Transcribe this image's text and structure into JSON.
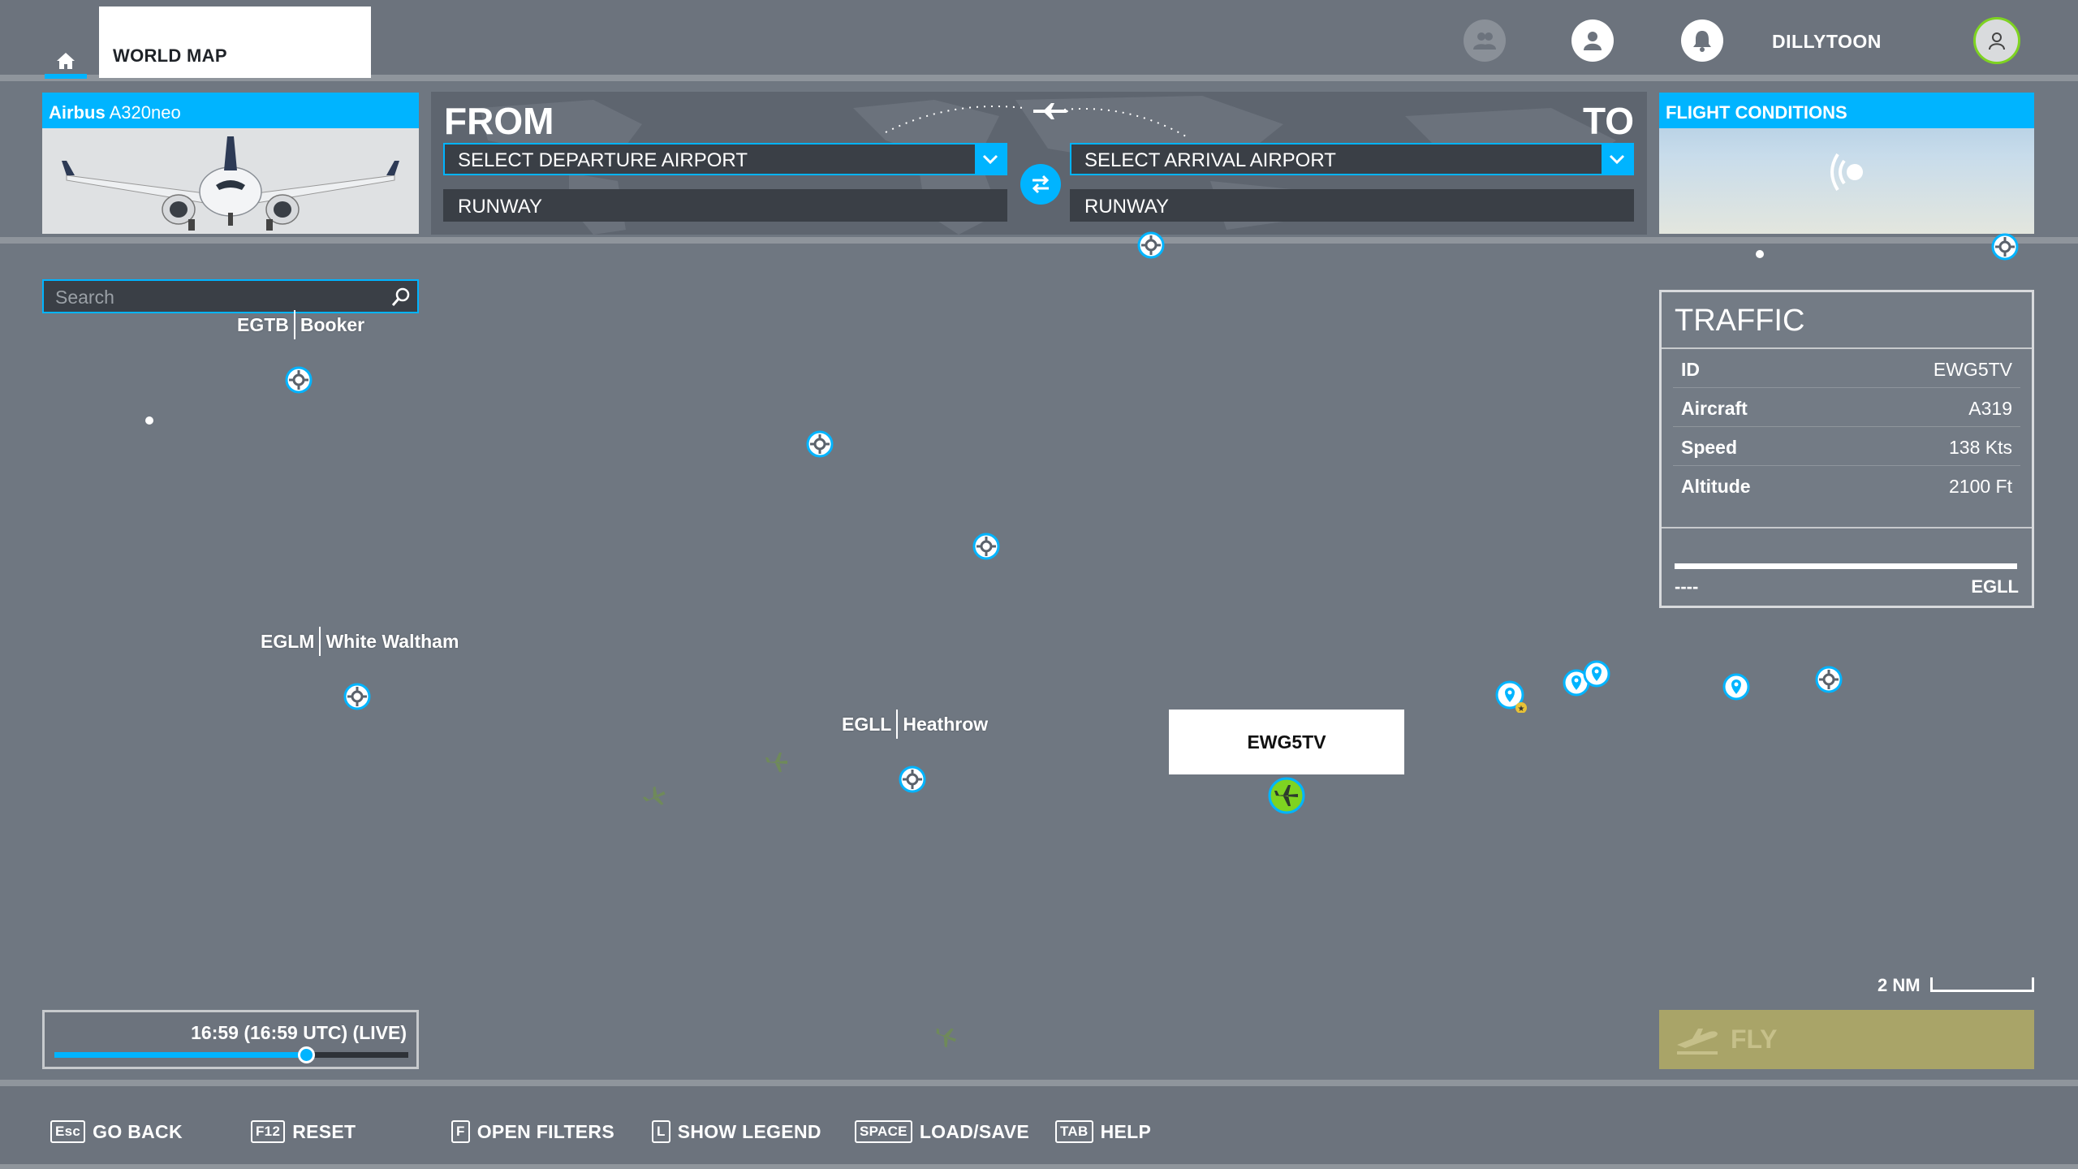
{
  "nav": {
    "world_map_tab": "WORLD MAP",
    "username": "DILLYTOON"
  },
  "aircraft": {
    "make": "Airbus",
    "model": "A320neo"
  },
  "route": {
    "from_label": "FROM",
    "to_label": "TO",
    "departure_placeholder": "SELECT DEPARTURE AIRPORT",
    "arrival_placeholder": "SELECT ARRIVAL AIRPORT",
    "departure_runway": "RUNWAY",
    "arrival_runway": "RUNWAY"
  },
  "conditions": {
    "title": "FLIGHT CONDITIONS"
  },
  "search": {
    "placeholder": "Search",
    "value": ""
  },
  "airports": [
    {
      "icao": "EGTB",
      "name": "Booker"
    },
    {
      "icao": "EGLM",
      "name": "White Waltham"
    },
    {
      "icao": "EGLL",
      "name": "Heathrow"
    }
  ],
  "selected_traffic": {
    "callsign": "EWG5TV"
  },
  "traffic": {
    "title": "TRAFFIC",
    "rows": [
      {
        "label": "ID",
        "value": "EWG5TV"
      },
      {
        "label": "Aircraft",
        "value": "A319"
      },
      {
        "label": "Speed",
        "value": "138 Kts"
      },
      {
        "label": "Altitude",
        "value": "2100 Ft"
      }
    ],
    "origin": "----",
    "destination": "EGLL"
  },
  "scale": {
    "label": "2 NM"
  },
  "fly_button": {
    "label": "FLY"
  },
  "time": {
    "label": "16:59 (16:59 UTC) (LIVE)",
    "slider_fraction": 0.71
  },
  "hints": [
    {
      "key": "Esc",
      "label": "GO BACK"
    },
    {
      "key": "F12",
      "label": "RESET"
    },
    {
      "key": "F",
      "label": "OPEN FILTERS"
    },
    {
      "key": "L",
      "label": "SHOW LEGEND"
    },
    {
      "key": "SPACE",
      "label": "LOAD/SAVE"
    },
    {
      "key": "TAB",
      "label": "HELP"
    }
  ],
  "colors": {
    "accent": "#00b4ff",
    "map_background": "#6f7781",
    "traffic_selected": "#7ed321",
    "fly_button": "#a9a468"
  },
  "icons": [
    "home-icon",
    "friends-icon",
    "profile-icon",
    "notification-bell-icon",
    "avatar-icon",
    "search-icon",
    "swap-icon",
    "chevron-down-icon",
    "weather-live-icon",
    "airport-marker-icon",
    "poi-pin-icon",
    "plane-icon",
    "takeoff-icon"
  ]
}
